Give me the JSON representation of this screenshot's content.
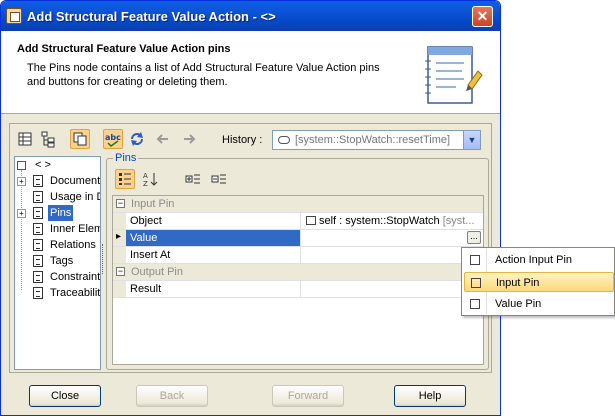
{
  "window": {
    "title": "Add Structural Feature Value Action - <>",
    "close_label": "✕"
  },
  "header": {
    "title": "Add Structural Feature Value Action pins",
    "description": "The Pins node contains a list of Add Structural Feature Value Action pins and buttons for creating or deleting them."
  },
  "toolbar": {
    "history_label": "History :",
    "history_value": "[system::StopWatch::resetTime]"
  },
  "tree": {
    "root_label": "< >",
    "items": [
      {
        "label": "Documentation/Hyperlinks",
        "expandable": true
      },
      {
        "label": "Usage in Diagrams",
        "expandable": false
      },
      {
        "label": "Pins",
        "expandable": true,
        "selected": true
      },
      {
        "label": "Inner Elements",
        "expandable": false
      },
      {
        "label": "Relations",
        "expandable": false
      },
      {
        "label": "Tags",
        "expandable": false
      },
      {
        "label": "Constraints",
        "expandable": false
      },
      {
        "label": "Traceability",
        "expandable": false
      }
    ]
  },
  "pins": {
    "legend": "Pins",
    "input_category": "Input Pin",
    "output_category": "Output Pin",
    "rows": {
      "object_name": "Object",
      "object_value_self": "self",
      "object_value_sep": " : ",
      "object_value_type": "system::StopWatch",
      "object_value_extra": " [syst...",
      "value_name": "Value",
      "insert_at_name": "Insert At",
      "result_name": "Result"
    },
    "ellipsis": "..."
  },
  "popup": {
    "items": [
      "Action Input Pin",
      "Input Pin",
      "Value Pin"
    ]
  },
  "buttons": {
    "close": "Close",
    "back": "Back",
    "forward": "Forward",
    "help": "Help"
  }
}
